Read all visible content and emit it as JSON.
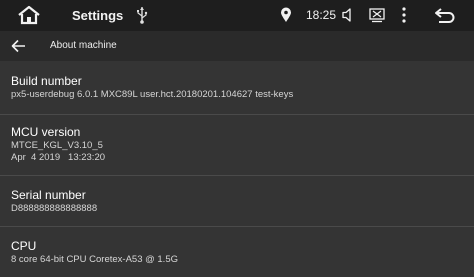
{
  "statusbar": {
    "title": "Settings",
    "time": "18:25"
  },
  "icons": {
    "home": "home-icon",
    "usb": "usb-icon",
    "location": "location-icon",
    "volume": "volume-icon",
    "screenshot": "screenshot-icon",
    "menu": "more-vert-icon",
    "back": "back-icon",
    "arrow": "arrow-back-icon"
  },
  "toolbar": {
    "title": "About machine"
  },
  "items": [
    {
      "label": "Build number",
      "value": "px5-userdebug 6.0.1 MXC89L user.hct.20180201.104627 test-keys"
    },
    {
      "label": "MCU version",
      "value": "MTCE_KGL_V3.10_5",
      "value2": "Apr  4 2019   13:23:20"
    },
    {
      "label": "Serial number",
      "value": "D888888888888888"
    },
    {
      "label": "CPU",
      "value": "8 core 64-bit CPU Coretex-A53 @ 1.5G"
    }
  ],
  "colors": {
    "statusbar_bg": "#1e1e1e",
    "toolbar_bg": "#2a2a2a",
    "content_bg": "#343434",
    "divider": "#4a4a4a"
  }
}
